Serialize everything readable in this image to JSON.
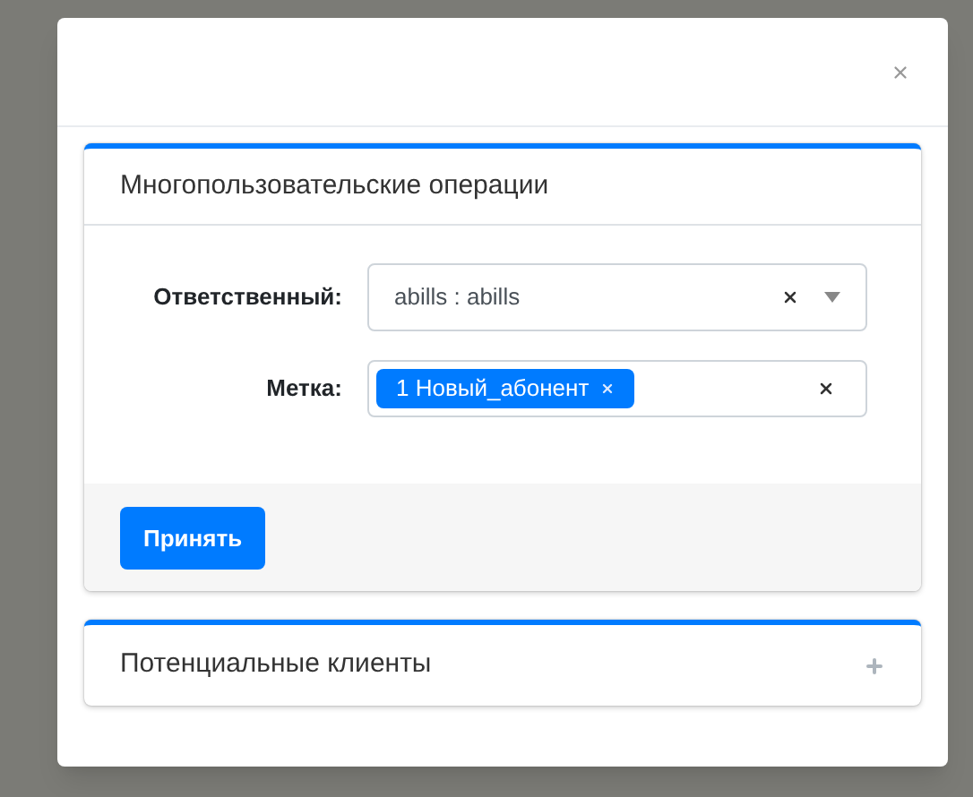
{
  "panels": [
    {
      "title": "Многопользовательские операции",
      "expanded": true,
      "fields": [
        {
          "kind": "select",
          "label": "Ответственный:",
          "value": "abills : abills"
        },
        {
          "kind": "tags",
          "label": "Метка:",
          "tags": [
            "1 Новый_абонент"
          ]
        }
      ],
      "submit": "Принять"
    },
    {
      "title": "Потенциальные клиенты",
      "expanded": false
    }
  ]
}
